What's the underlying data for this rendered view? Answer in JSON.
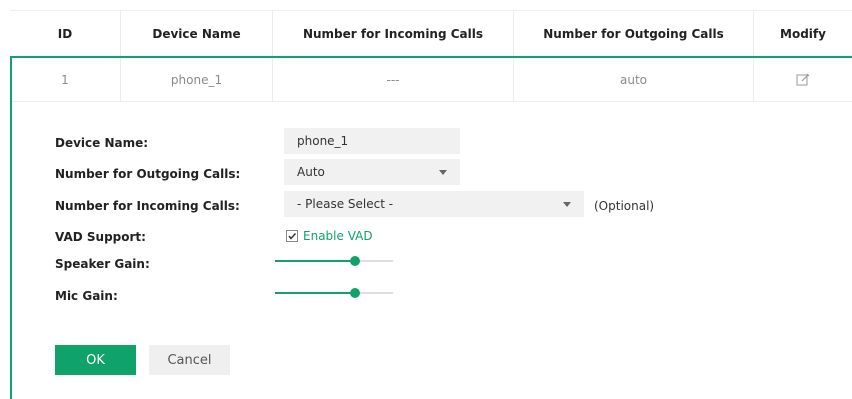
{
  "table": {
    "headers": {
      "id": "ID",
      "device_name": "Device Name",
      "incoming": "Number for Incoming Calls",
      "outgoing": "Number for Outgoing Calls",
      "modify": "Modify"
    },
    "rows": [
      {
        "id": "1",
        "device_name": "phone_1",
        "incoming": "---",
        "outgoing": "auto",
        "modify_icon": "edit-icon"
      }
    ]
  },
  "form": {
    "device_name": {
      "label": "Device Name:",
      "value": "phone_1"
    },
    "outgoing": {
      "label": "Number for Outgoing Calls:",
      "value": "Auto"
    },
    "incoming": {
      "label": "Number for Incoming Calls:",
      "value": "- Please Select -",
      "note": "(Optional)"
    },
    "vad": {
      "label": "VAD Support:",
      "checkbox_label": "Enable VAD",
      "checked": true
    },
    "speaker_gain": {
      "label": "Speaker Gain:",
      "level": 0.68
    },
    "mic_gain": {
      "label": "Mic Gain:",
      "level": 0.68
    },
    "ok_label": "OK",
    "cancel_label": "Cancel"
  },
  "colors": {
    "accent": "#0fa36b",
    "field_bg": "#f1f1f1"
  }
}
